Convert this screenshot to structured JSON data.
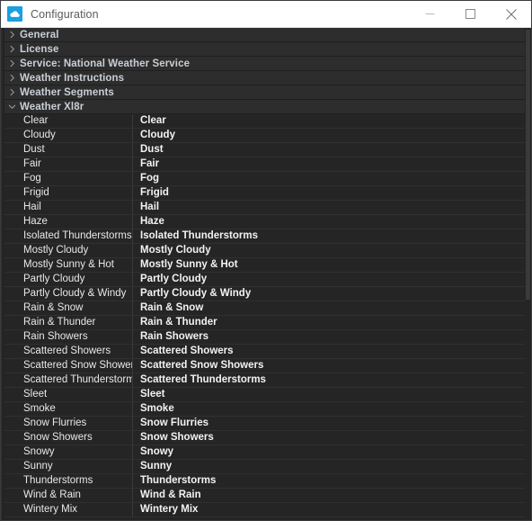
{
  "window": {
    "title": "Configuration",
    "app_icon": "cloud-icon",
    "controls": {
      "minimize": "minimize-icon",
      "maximize": "maximize-icon",
      "close": "close-icon"
    }
  },
  "tree": {
    "categories": [
      {
        "label": "General",
        "expanded": false,
        "chevron": "chevron-right-icon"
      },
      {
        "label": "License",
        "expanded": false,
        "chevron": "chevron-right-icon"
      },
      {
        "label": "Service: National Weather Service",
        "expanded": false,
        "chevron": "chevron-right-icon"
      },
      {
        "label": "Weather Instructions",
        "expanded": false,
        "chevron": "chevron-right-icon"
      },
      {
        "label": "Weather Segments",
        "expanded": false,
        "chevron": "chevron-right-icon"
      },
      {
        "label": "Weather Xl8r",
        "expanded": true,
        "chevron": "chevron-down-icon"
      }
    ],
    "rows": [
      {
        "key": "Clear",
        "value": "Clear"
      },
      {
        "key": "Cloudy",
        "value": "Cloudy"
      },
      {
        "key": "Dust",
        "value": "Dust"
      },
      {
        "key": "Fair",
        "value": "Fair"
      },
      {
        "key": "Fog",
        "value": "Fog"
      },
      {
        "key": "Frigid",
        "value": "Frigid"
      },
      {
        "key": "Hail",
        "value": "Hail"
      },
      {
        "key": "Haze",
        "value": "Haze"
      },
      {
        "key": "Isolated Thunderstorms",
        "value": "Isolated Thunderstorms"
      },
      {
        "key": "Mostly Cloudy",
        "value": "Mostly Cloudy"
      },
      {
        "key": "Mostly Sunny & Hot",
        "value": "Mostly Sunny & Hot"
      },
      {
        "key": "Partly Cloudy",
        "value": "Partly Cloudy"
      },
      {
        "key": "Partly Cloudy & Windy",
        "value": "Partly Cloudy & Windy"
      },
      {
        "key": "Rain & Snow",
        "value": "Rain & Snow"
      },
      {
        "key": "Rain & Thunder",
        "value": "Rain & Thunder"
      },
      {
        "key": "Rain Showers",
        "value": "Rain Showers"
      },
      {
        "key": "Scattered Showers",
        "value": "Scattered Showers"
      },
      {
        "key": "Scattered Snow Showers",
        "value": "Scattered Snow Showers"
      },
      {
        "key": "Scattered Thunderstorms",
        "value": "Scattered Thunderstorms"
      },
      {
        "key": "Sleet",
        "value": "Sleet"
      },
      {
        "key": "Smoke",
        "value": "Smoke"
      },
      {
        "key": "Snow Flurries",
        "value": "Snow Flurries"
      },
      {
        "key": "Snow Showers",
        "value": "Snow Showers"
      },
      {
        "key": "Snowy",
        "value": "Snowy"
      },
      {
        "key": "Sunny",
        "value": "Sunny"
      },
      {
        "key": "Thunderstorms",
        "value": "Thunderstorms"
      },
      {
        "key": "Wind & Rain",
        "value": "Wind & Rain"
      },
      {
        "key": "Wintery Mix",
        "value": "Wintery Mix"
      }
    ]
  },
  "colors": {
    "titlebar_bg": "#ffffff",
    "titlebar_text": "#5a5a5a",
    "app_icon_bg": "#1a9fe0",
    "category_bg": "#2d2d2d",
    "category_text": "#c9cfd6",
    "row_bg": "#252526",
    "row_key_text": "#e8e8e8",
    "row_value_text": "#f2f2f2"
  }
}
